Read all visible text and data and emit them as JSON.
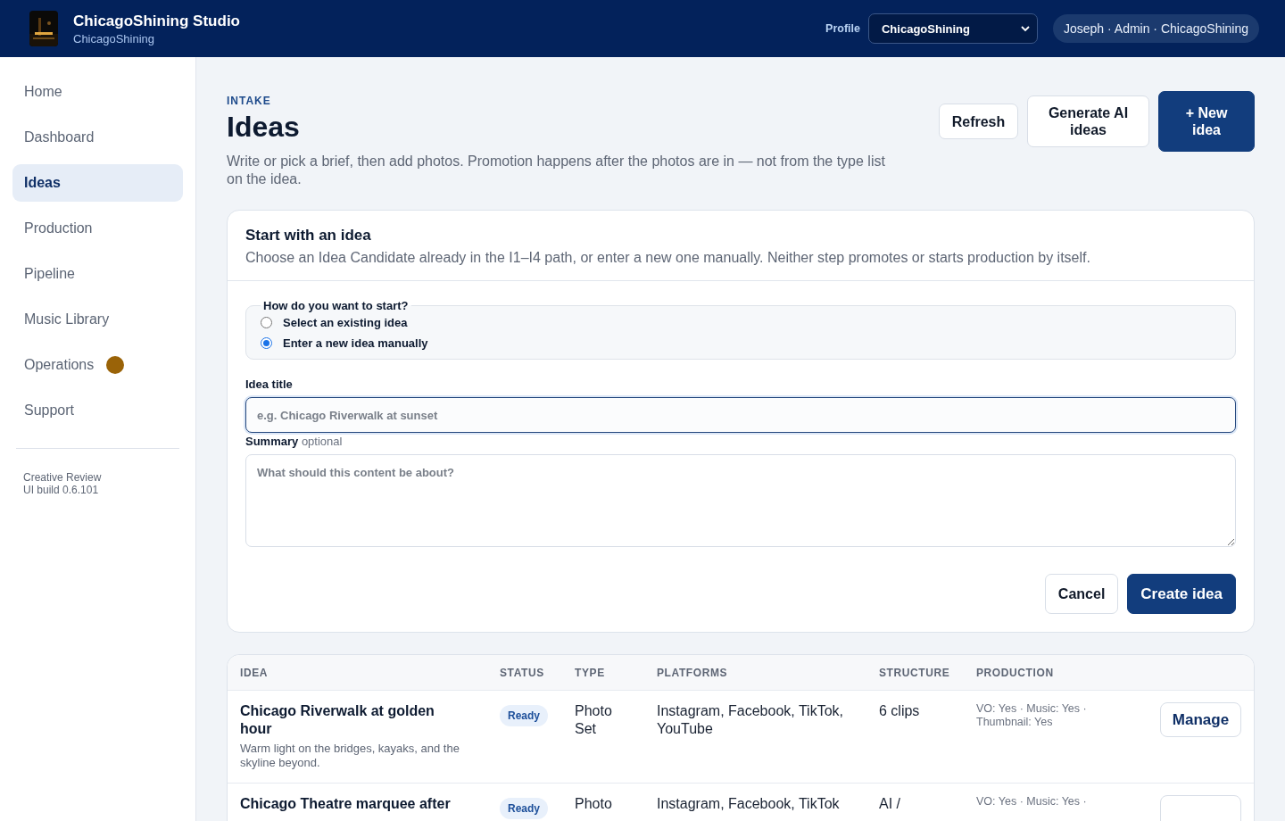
{
  "header": {
    "brand": "ChicagoShining Studio",
    "subtitle": "ChicagoShining",
    "profile_label": "Profile",
    "profile_value": "ChicagoShining",
    "user": "Joseph · Admin · ChicagoShining"
  },
  "sidebar": {
    "items": [
      {
        "label": "Home",
        "selected": false
      },
      {
        "label": "Dashboard",
        "selected": false
      },
      {
        "label": "Ideas",
        "selected": true
      },
      {
        "label": "Production",
        "selected": false
      },
      {
        "label": "Pipeline",
        "selected": false
      },
      {
        "label": "Music Library",
        "selected": false
      },
      {
        "label": "Operations",
        "selected": false,
        "dot": {
          "color": "#9a6308"
        }
      },
      {
        "label": "Support",
        "selected": false
      }
    ],
    "footer": [
      "Creative Review",
      "UI build 0.6.101"
    ]
  },
  "page": {
    "eyebrow": "INTAKE",
    "title": "Ideas",
    "description": "Write or pick a brief, then add photos. Promotion happens after the photos are in — not from the type list on the idea.",
    "actions": [
      {
        "label": "Refresh",
        "kind": "secondary"
      },
      {
        "label": "Generate AI ideas",
        "kind": "secondary"
      },
      {
        "label": "+ New idea",
        "kind": "primary"
      }
    ]
  },
  "form": {
    "title": "Start with an idea",
    "description": "Choose an Idea Candidate already in the I1–I4 path, or enter a new one manually. Neither step promotes or starts production by itself.",
    "legend": "How do you want to start?",
    "options": [
      {
        "label": "Select an existing idea",
        "selected": false
      },
      {
        "label": "Enter a new idea manually",
        "selected": true
      }
    ],
    "title_label": "Idea title",
    "title_placeholder": "e.g. Chicago Riverwalk at sunset",
    "summary_label": "Summary",
    "summary_hint": "optional",
    "summary_placeholder": "What should this content be about?",
    "buttons": [
      {
        "label": "Cancel",
        "kind": "secondary"
      },
      {
        "label": "Create idea",
        "kind": "primary"
      }
    ]
  },
  "table": {
    "columns": [
      "IDEA",
      "STATUS",
      "TYPE",
      "PLATFORMS",
      "STRUCTURE",
      "PRODUCTION"
    ],
    "rows": [
      {
        "title": "Chicago Riverwalk at golden hour",
        "summary": "Warm light on the bridges, kayaks, and the skyline beyond.",
        "status": "Ready",
        "type": "Photo Set",
        "platforms": "Instagram, Facebook, TikTok, YouTube",
        "structure": "6 clips",
        "production": "VO: Yes · Music: Yes · Thumbnail: Yes",
        "action": "Manage"
      },
      {
        "title": "Chicago Theatre marquee after",
        "status": "Ready",
        "type": "Photo",
        "platforms": "Instagram, Facebook, TikTok",
        "structure": "AI /",
        "production": "VO: Yes · Music: Yes ·"
      }
    ]
  }
}
